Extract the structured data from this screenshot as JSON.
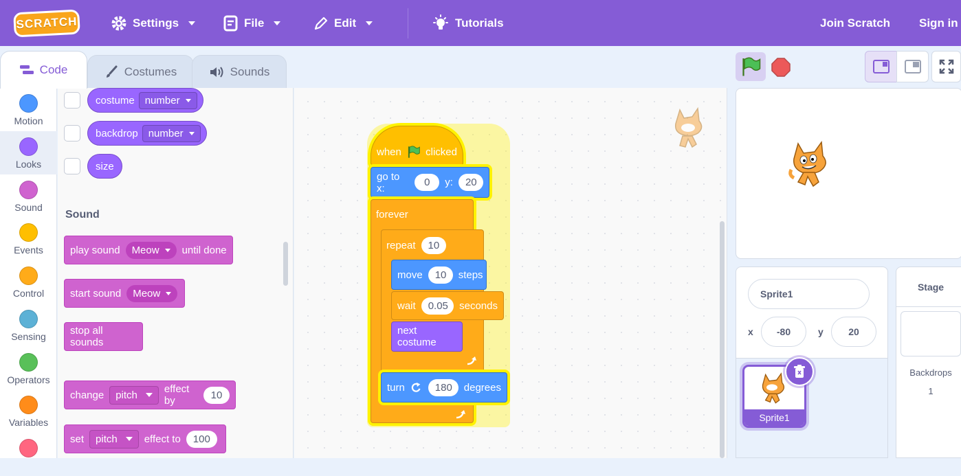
{
  "menu": {
    "logo_text": "SCRATCH",
    "settings": "Settings",
    "file": "File",
    "edit": "Edit",
    "tutorials": "Tutorials",
    "join": "Join Scratch",
    "signin": "Sign in"
  },
  "tabs": {
    "code": "Code",
    "costumes": "Costumes",
    "sounds": "Sounds"
  },
  "categories": [
    {
      "label": "Motion",
      "color": "#4c97ff"
    },
    {
      "label": "Looks",
      "color": "#9966ff"
    },
    {
      "label": "Sound",
      "color": "#cf63cf"
    },
    {
      "label": "Events",
      "color": "#ffbf00"
    },
    {
      "label": "Control",
      "color": "#ffab19"
    },
    {
      "label": "Sensing",
      "color": "#5cb1d6"
    },
    {
      "label": "Operators",
      "color": "#59c059"
    },
    {
      "label": "Variables",
      "color": "#ff8c1a"
    }
  ],
  "palette": {
    "costume_label": "costume",
    "costume_dd": "number",
    "backdrop_label": "backdrop",
    "backdrop_dd": "number",
    "size_label": "size",
    "sound_heading": "Sound",
    "play_sound": {
      "pre": "play sound",
      "dd": "Meow",
      "post": "until done"
    },
    "start_sound": {
      "pre": "start sound",
      "dd": "Meow"
    },
    "stop_all": "stop all sounds",
    "change_effect": {
      "pre": "change",
      "dd": "pitch",
      "mid": "effect by",
      "val": "10"
    },
    "set_effect": {
      "pre": "set",
      "dd": "pitch",
      "mid": "effect to",
      "val": "100"
    }
  },
  "script": {
    "when": "when",
    "clicked": "clicked",
    "goto_pre": "go to x:",
    "goto_x": "0",
    "goto_y_label": "y:",
    "goto_y": "20",
    "forever": "forever",
    "repeat": "repeat",
    "repeat_n": "10",
    "move": "move",
    "move_n": "10",
    "steps": "steps",
    "wait": "wait",
    "wait_n": "0.05",
    "seconds": "seconds",
    "next_costume": "next costume",
    "turn": "turn",
    "turn_n": "180",
    "degrees": "degrees"
  },
  "sprite_info": {
    "name": "Sprite1",
    "x_label": "x",
    "x": "-80",
    "y_label": "y",
    "y": "20"
  },
  "sprite_tile": {
    "name": "Sprite1"
  },
  "stage_pane": {
    "title": "Stage",
    "backdrops_label": "Backdrops",
    "backdrops_count": "1"
  }
}
